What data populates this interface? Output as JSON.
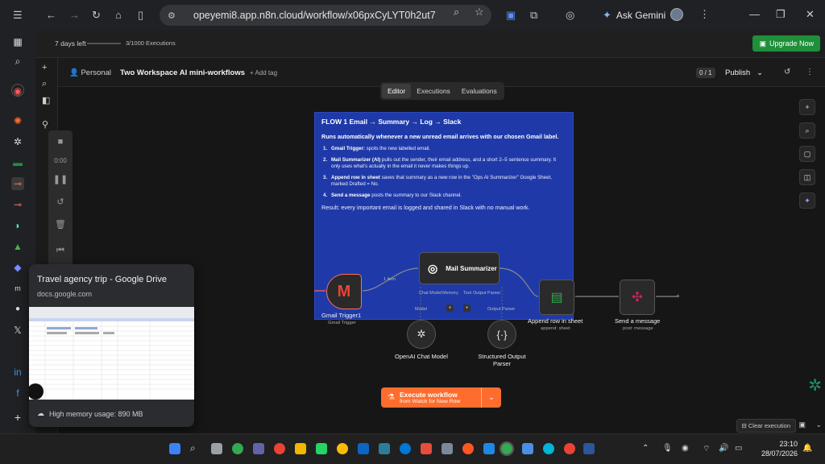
{
  "browser": {
    "url": "opeyemi8.app.n8n.cloud/workflow/x06pxCyLYT0h2ut7",
    "ask_gemini": "Ask Gemini"
  },
  "trial": {
    "days_left": "7 days left",
    "executions": "3/1000 Executions",
    "upgrade_label": "Upgrade Now"
  },
  "header": {
    "personal": "Personal",
    "workflow_title": "Two Workspace AI mini-workflows",
    "add_tag": "+ Add tag",
    "counter": "0 / 1",
    "publish": "Publish"
  },
  "tabs": [
    "Editor",
    "Executions",
    "Evaluations"
  ],
  "sticky": {
    "title": "FLOW 1 Email → Summary → Log → Slack",
    "intro": "Runs automatically whenever a new unread email arrives with our chosen Gmail label.",
    "steps": [
      {
        "n": "1.",
        "bold": "Gmail Trigger:",
        "text": " spots the new labelled email."
      },
      {
        "n": "2.",
        "bold": "Mail Summarizer (AI)",
        "text": " pulls out the sender, their email address, and a short 2–5 sentence summary. It only uses what's actually in the email it never makes things up."
      },
      {
        "n": "3.",
        "bold": "Append row in sheet",
        "text": " saves that summary as a new row in the \"Ops AI Summarizer\" Google Sheet, marked Drafted = No."
      },
      {
        "n": "4.",
        "bold": "Send a message",
        "text": " posts the summary to our Slack channel."
      }
    ],
    "result": "Result: every important email is logged and shared in Slack with no manual work."
  },
  "nodes": {
    "gmail": {
      "label": "Gmail Trigger1",
      "sub": "Gmail Trigger"
    },
    "summarizer": {
      "label": "Mail Summarizer",
      "chat_memory": "Chat Model",
      "memory": "Memory",
      "tool": "Tool",
      "parser": "Output Parser"
    },
    "sheet": {
      "label": "Append row in sheet",
      "sub": "append: sheet"
    },
    "slack": {
      "label": "Send a message",
      "sub": "post: message"
    },
    "openai": {
      "label": "OpenAI Chat Model",
      "port": "Model"
    },
    "parser": {
      "label": "Structured Output Parser",
      "port": "Output Parser"
    },
    "edge_label": "1 item"
  },
  "execute": {
    "title": "Execute workflow",
    "sub": "from Watch for New Row"
  },
  "clear_execution": "Clear execution",
  "exec_timer": "0:00",
  "tab_card": {
    "title": "Travel agency trip - Google Drive",
    "url": "docs.google.com",
    "memory": "High memory usage: 890 MB"
  },
  "taskbar": {
    "time": "23:10",
    "date": "28/07/2026"
  },
  "colors": {
    "accent_orange": "#ff6d2e",
    "sticky_blue": "#1f3aa8",
    "upgrade_green": "#1f8f3a"
  }
}
